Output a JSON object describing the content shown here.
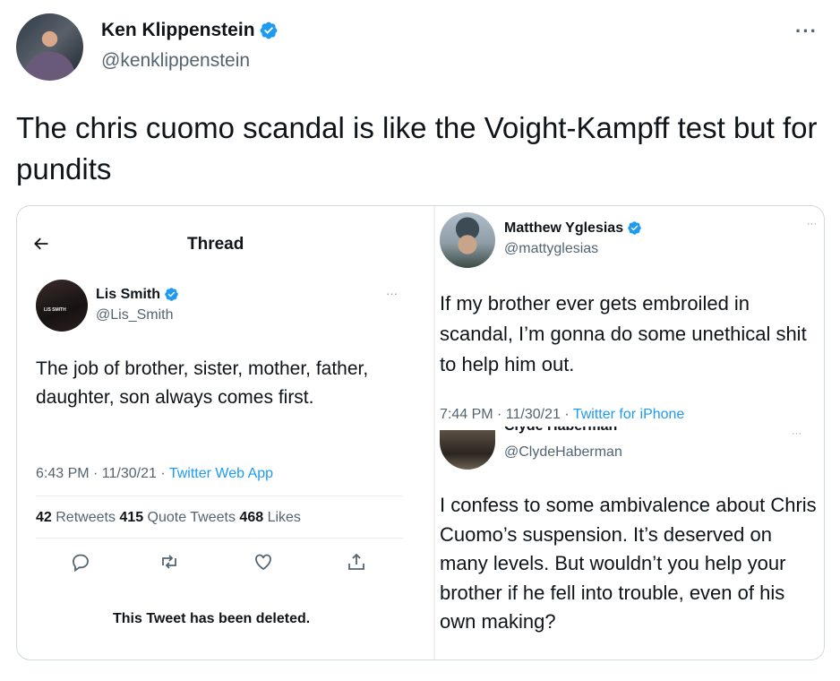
{
  "tweet": {
    "author_name": "Ken Klippenstein",
    "author_handle": "@kenklippenstein",
    "more_icon": "more-horizontal-icon",
    "text": "The chris cuomo scandal is like the Voight-Kampff test but for pundits"
  },
  "colors": {
    "verified_blue": "#1d9bf0",
    "text_primary": "#0f1419",
    "text_secondary": "#536471",
    "link_blue": "#1d9bf0",
    "border": "#cfd9de"
  },
  "embedded": {
    "lis": {
      "header_title": "Thread",
      "name": "Lis Smith",
      "handle": "@Lis_Smith",
      "avatar_caption": "LIS SMITH",
      "text": "The job of brother, sister, mother, father, daughter, son always comes first.",
      "time": "6:43 PM · 11/30/21 · ",
      "source": "Twitter Web App",
      "retweets_count": "42",
      "retweets_label": " Retweets ",
      "quotes_count": "415",
      "quotes_label": " Quote Tweets ",
      "likes_count": "468",
      "likes_label": " Likes",
      "deleted_notice": "This Tweet has been deleted."
    },
    "matt": {
      "name": "Matthew Yglesias",
      "handle": "@mattyglesias",
      "text": "If my brother ever gets embroiled in scandal, I’m gonna do some unethical shit to help him out.",
      "time": "7:44 PM · 11/30/21 · ",
      "source": "Twitter for iPhone"
    },
    "clyde": {
      "name": "Clyde Haberman",
      "handle": "@ClydeHaberman",
      "text": "I confess to some ambivalence about Chris Cuomo’s suspension. It’s deserved on many levels. But wouldn’t you help your brother if he fell into trouble, even of his own making?"
    }
  }
}
